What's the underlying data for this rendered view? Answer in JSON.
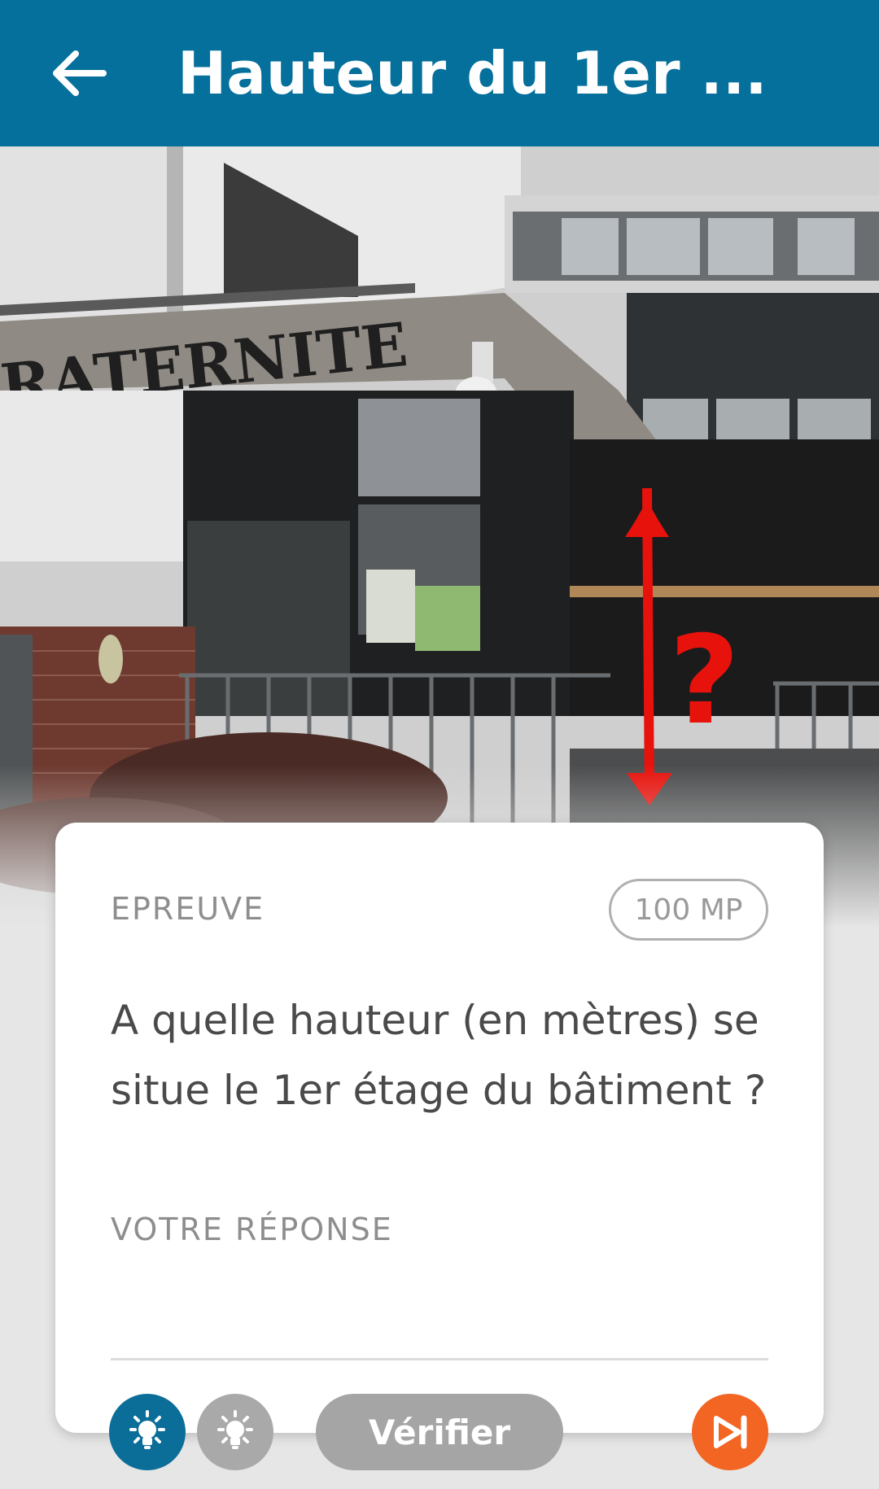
{
  "header": {
    "back_icon": "arrow-left-icon",
    "title": "Hauteur du 1er ..."
  },
  "photo": {
    "sign_text": "RATERNITE",
    "overlay_mark": "?",
    "overlay_color": "#e8120c"
  },
  "card": {
    "section_label": "EPREUVE",
    "points_badge": "100 MP",
    "question": "A quelle hauteur (en mètres) se situe le 1er étage du bâtiment ?",
    "answer_label": "VOTRE RÉPONSE",
    "answer_value": ""
  },
  "actions": {
    "hint_1_icon": "lightbulb-icon",
    "hint_2_icon": "lightbulb-icon",
    "verify_label": "Vérifier",
    "skip_icon": "skip-next-icon"
  },
  "colors": {
    "appbar": "#05709b",
    "hint_active": "#0a6e99",
    "hint_inactive": "#a9a9a9",
    "skip": "#f26522",
    "verify_disabled": "#a5a5a5"
  }
}
